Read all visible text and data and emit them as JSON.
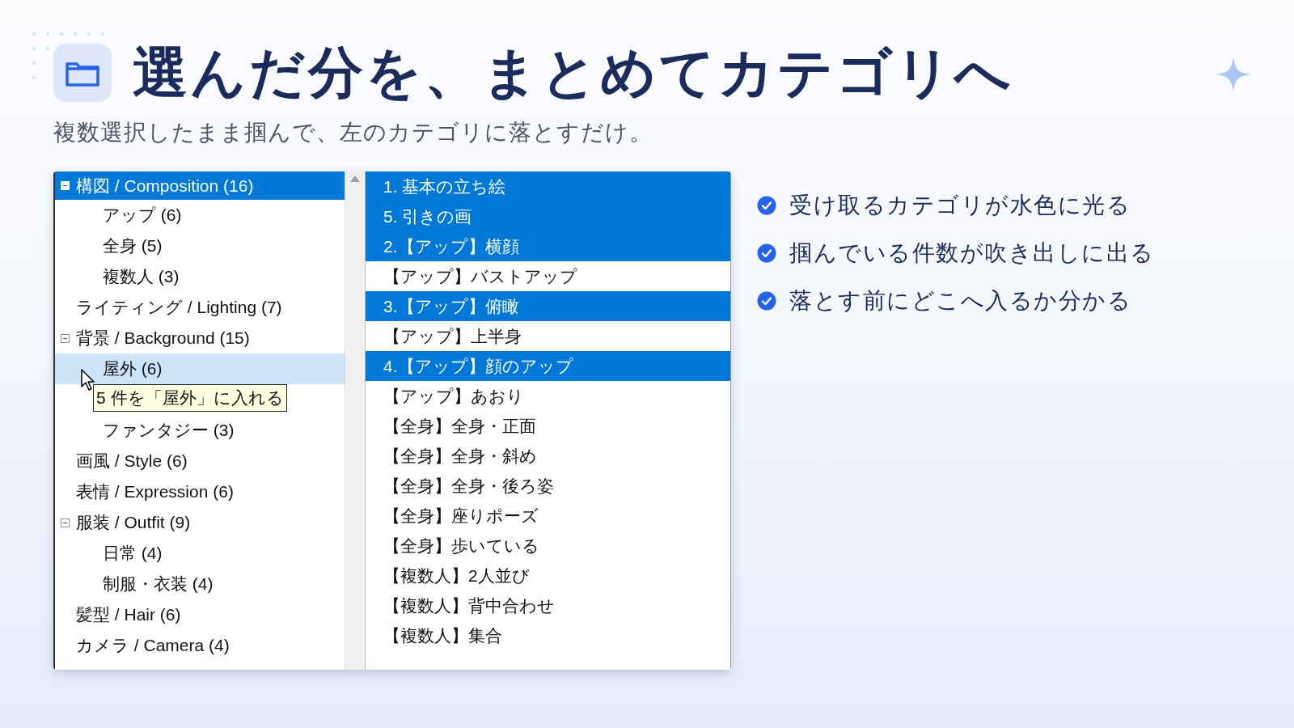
{
  "header": {
    "title": "選んだ分を、まとめてカテゴリへ",
    "subtitle": "複数選択したまま掴んで、左のカテゴリに落とすだけ。"
  },
  "category_tree": [
    {
      "kind": "category",
      "label": "構図 / Composition (16)",
      "expanded": true,
      "selected": true,
      "drop_target": false,
      "children": [
        {
          "kind": "category",
          "label": "アップ (6)",
          "selected": false,
          "drop_target": false
        },
        {
          "kind": "category",
          "label": "全身 (5)",
          "selected": false,
          "drop_target": false
        },
        {
          "kind": "category",
          "label": "複数人 (3)",
          "selected": false,
          "drop_target": false
        }
      ]
    },
    {
      "kind": "category",
      "label": "ライティング / Lighting (7)",
      "selected": false,
      "drop_target": false
    },
    {
      "kind": "category",
      "label": "背景 / Background (15)",
      "expanded": true,
      "selected": false,
      "drop_target": false,
      "children": [
        {
          "kind": "category",
          "label": "屋外 (6)",
          "selected": false,
          "drop_target": true
        },
        {
          "kind": "covered"
        },
        {
          "kind": "category",
          "label": "ファンタジー (3)",
          "selected": false,
          "drop_target": false
        }
      ]
    },
    {
      "kind": "category",
      "label": "画風 / Style (6)",
      "selected": false,
      "drop_target": false
    },
    {
      "kind": "category",
      "label": "表情 / Expression (6)",
      "selected": false,
      "drop_target": false
    },
    {
      "kind": "category",
      "label": "服装 / Outfit (9)",
      "expanded": true,
      "selected": false,
      "drop_target": false,
      "children": [
        {
          "kind": "category",
          "label": "日常 (4)",
          "selected": false,
          "drop_target": false
        },
        {
          "kind": "category",
          "label": "制服・衣装 (4)",
          "selected": false,
          "drop_target": false
        }
      ]
    },
    {
      "kind": "category",
      "label": "髪型 / Hair (6)",
      "selected": false,
      "drop_target": false
    },
    {
      "kind": "category",
      "label": "カメラ / Camera (4)",
      "selected": false,
      "drop_target": false
    }
  ],
  "drag_tooltip": {
    "text": "5 件を「屋外」に入れる"
  },
  "prompt_list": [
    {
      "label": "1. 基本の立ち絵",
      "selected": true
    },
    {
      "label": "5. 引きの画",
      "selected": true
    },
    {
      "label": "2.【アップ】横顔",
      "selected": true
    },
    {
      "label": "【アップ】バストアップ",
      "selected": false
    },
    {
      "label": "3.【アップ】俯瞰",
      "selected": true
    },
    {
      "label": "【アップ】上半身",
      "selected": false
    },
    {
      "label": "4.【アップ】顔のアップ",
      "selected": true
    },
    {
      "label": "【アップ】あおり",
      "selected": false
    },
    {
      "label": "【全身】全身・正面",
      "selected": false
    },
    {
      "label": "【全身】全身・斜め",
      "selected": false
    },
    {
      "label": "【全身】全身・後ろ姿",
      "selected": false
    },
    {
      "label": "【全身】座りポーズ",
      "selected": false
    },
    {
      "label": "【全身】歩いている",
      "selected": false
    },
    {
      "label": "【複数人】2人並び",
      "selected": false
    },
    {
      "label": "【複数人】背中合わせ",
      "selected": false
    },
    {
      "label": "【複数人】集合",
      "selected": false
    }
  ],
  "features": [
    {
      "text": "受け取るカテゴリが水色に光る",
      "checked": true
    },
    {
      "text": "掴んでいる件数が吹き出しに出る",
      "checked": true
    },
    {
      "text": "落とす前にどこへ入るか分かる",
      "checked": true
    }
  ]
}
